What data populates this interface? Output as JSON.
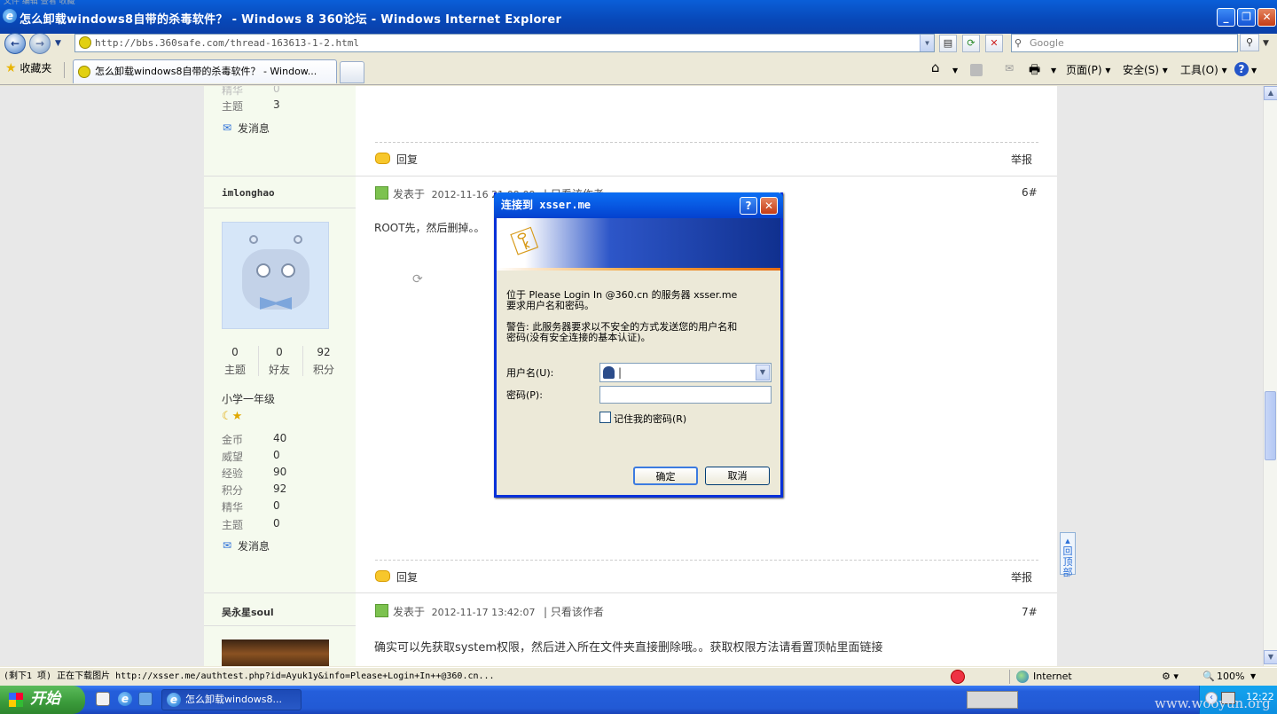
{
  "window": {
    "title": "怎么卸载windows8自带的杀毒软件？ - Windows 8 360论坛 - Windows Internet Explorer",
    "menu_faint": "文件  编辑  查看  收藏"
  },
  "addressbar": {
    "url": "http://bbs.360safe.com/thread-163613-1-2.html",
    "search_placeholder": "Google"
  },
  "tabs": {
    "favorites": "收藏夹",
    "active_tab": "怎么卸载windows8自带的杀毒软件？ - Window..."
  },
  "commandbar": {
    "page": "页面(P)",
    "safety": "安全(S)",
    "tools": "工具(O)"
  },
  "post_top": {
    "row_label": "主题",
    "row_value": "3",
    "faint_label": "精华",
    "faint_value": "0",
    "send_msg": "发消息",
    "reply": "回复",
    "report": "举报"
  },
  "post_6": {
    "author": "imlonghao",
    "posted_prefix": "发表于",
    "posted_time": "2012-11-16 21:09:09",
    "only_author": "只看该作者",
    "floor": "6#",
    "body": "ROOT先，然后删掉。。",
    "stats": [
      {
        "value": "0",
        "label": "主题"
      },
      {
        "value": "0",
        "label": "好友"
      },
      {
        "value": "92",
        "label": "积分"
      }
    ],
    "rank": "小学一年级",
    "profile": [
      {
        "label": "金币",
        "value": "40"
      },
      {
        "label": "威望",
        "value": "0"
      },
      {
        "label": "经验",
        "value": "90"
      },
      {
        "label": "积分",
        "value": "92"
      },
      {
        "label": "精华",
        "value": "0"
      },
      {
        "label": "主题",
        "value": "0"
      }
    ],
    "send_msg": "发消息",
    "reply": "回复",
    "report": "举报"
  },
  "post_7": {
    "author": "吴永星soul",
    "posted_prefix": "发表于",
    "posted_time": "2012-11-17 13:42:07",
    "only_author": "只看该作者",
    "floor": "7#",
    "body": "确实可以先获取system权限，然后进入所在文件夹直接删除哦。。获取权限方法请看置顶帖里面链接"
  },
  "back_to_top": "回顶部",
  "dialog": {
    "title": "连接到 xsser.me",
    "line1": "位于 Please Login In  @360.cn 的服务器 xsser.me",
    "line2": "要求用户名和密码。",
    "warn1": "警告: 此服务器要求以不安全的方式发送您的用户名和",
    "warn2": "密码(没有安全连接的基本认证)。",
    "username_label": "用户名(U):",
    "username_value": "|",
    "password_label": "密码(P):",
    "password_value": "",
    "remember": "记住我的密码(R)",
    "ok": "确定",
    "cancel": "取消"
  },
  "statusbar": {
    "text": "(剩下1 项) 正在下载图片 http://xsser.me/authtest.php?id=Ayuk1y&info=Please+Login+In++@360.cn...",
    "zone": "Internet",
    "zoom": "100%"
  },
  "taskbar": {
    "start": "开始",
    "task": "怎么卸载windows8...",
    "time": "12:22"
  },
  "watermark": "www.wooyun.org"
}
